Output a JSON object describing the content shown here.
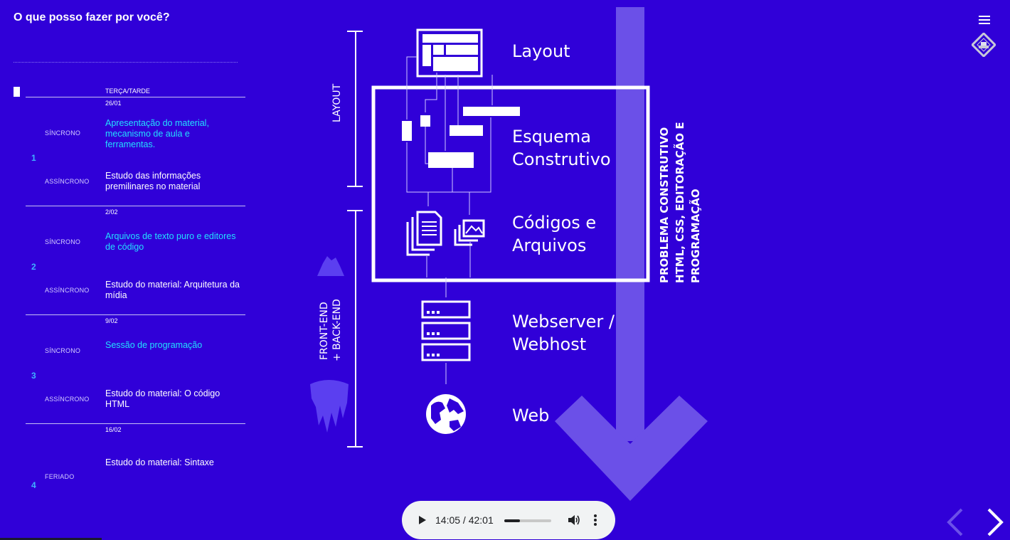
{
  "page": {
    "title": "O que posso fazer por você?"
  },
  "schedule": {
    "header": "TERÇA/TARDE",
    "weeks": [
      {
        "num": "1",
        "date": "26/01",
        "row1_type": "SÍNCRONO",
        "row1_text": "Apresentação do material, mecanismo de aula e ferramentas.",
        "row2_type": "ASSÍNCRONO",
        "row2_text": "Estudo das informações premilinares no material"
      },
      {
        "num": "2",
        "date": "2/02",
        "row1_type": "SÍNCRONO",
        "row1_text": "Arquivos de texto puro e editores de código",
        "row2_type": "ASSÍNCRONO",
        "row2_text": "Estudo do material: Arquitetura da mídia"
      },
      {
        "num": "3",
        "date": "9/02",
        "row1_type": "SÍNCRONO",
        "row1_text": "Sessão de programação",
        "row2_type": "ASSÍNCRONO",
        "row2_text": "Estudo do material: O código HTML"
      },
      {
        "num": "4",
        "date": "16/02",
        "row1_type": "",
        "row1_text": "",
        "row2_type": "FERIADO",
        "row2_text": "Estudo do material: Sintaxe"
      }
    ]
  },
  "diagram": {
    "bracket_top": "LAYOUT",
    "bracket_bottom_1": "FRONT-END",
    "bracket_bottom_2": "+ BACK-END",
    "steps": [
      {
        "line1": "Layout",
        "line2": ""
      },
      {
        "line1": "Esquema",
        "line2": "Construtivo"
      },
      {
        "line1": "Códigos e",
        "line2": "Arquivos"
      },
      {
        "line1": "Webserver /",
        "line2": "Webhost"
      },
      {
        "line1": "Web",
        "line2": ""
      }
    ],
    "side_label_1": "PROBLEMA CONSTRUTIVO",
    "side_label_2": "HTML, CSS, EDITORAÇÃO E",
    "side_label_3": "PROGRAMAÇÃO",
    "colors": {
      "background": "#3000d8",
      "arrow": "#6b50e8",
      "accent_sync": "#22e0ff",
      "week_num": "#3fb2ff"
    }
  },
  "audio": {
    "current_time": "14:05",
    "separator": " / ",
    "duration": "42:01",
    "progress_fraction": 0.335,
    "play_icon": "play-icon",
    "volume_icon": "volume-icon",
    "more_icon": "more-vertical-icon"
  },
  "nav": {
    "prev_icon": "chevron-left-icon",
    "next_icon": "chevron-right-icon",
    "menu_icon": "hamburger-menu-icon"
  }
}
